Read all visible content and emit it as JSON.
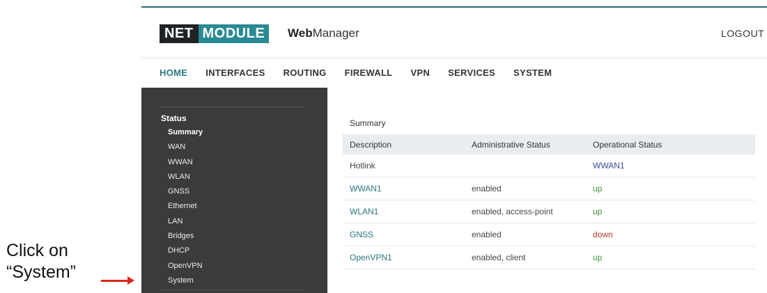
{
  "brand": {
    "net": "NET",
    "module": "MODULE",
    "app_bold": "Web",
    "app_rest": "Manager"
  },
  "header": {
    "logout": "LOGOUT"
  },
  "nav": [
    "HOME",
    "INTERFACES",
    "ROUTING",
    "FIREWALL",
    "VPN",
    "SERVICES",
    "SYSTEM"
  ],
  "sidebar": {
    "title": "Status",
    "items": [
      "Summary",
      "WAN",
      "WWAN",
      "WLAN",
      "GNSS",
      "Ethernet",
      "LAN",
      "Bridges",
      "DHCP",
      "OpenVPN",
      "System"
    ]
  },
  "main": {
    "title": "Summary",
    "columns": [
      "Description",
      "Administrative Status",
      "Operational Status"
    ],
    "rows": [
      [
        "Hotlink",
        "",
        "WWAN1"
      ],
      [
        "WWAN1",
        "enabled",
        "up"
      ],
      [
        "WLAN1",
        "enabled, access-point",
        "up"
      ],
      [
        "GNSS",
        "enabled",
        "down"
      ],
      [
        "OpenVPN1",
        "enabled, client",
        "up"
      ]
    ]
  },
  "annotation": {
    "line1": "Click on",
    "line2": "“System”"
  },
  "colors": {
    "accent": "#2a7680",
    "up": "#3c8f3c",
    "down": "#b03a2e",
    "arrow": "#e0231b"
  }
}
